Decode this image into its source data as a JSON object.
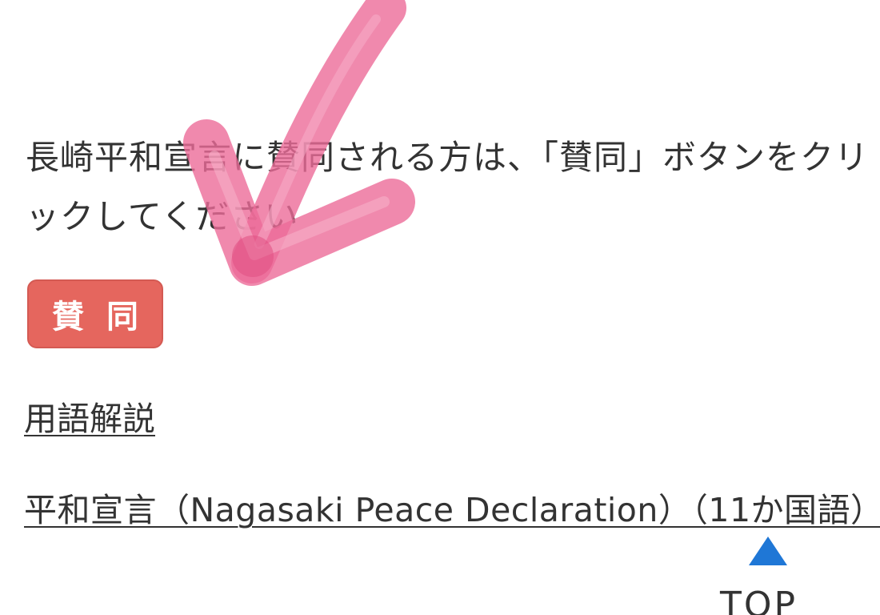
{
  "instruction_text": "長崎平和宣言に賛同される方は、「賛同」ボタンをクリックしてください",
  "agree_button_label": "賛同",
  "links": {
    "glossary": "用語解説",
    "declaration": "平和宣言（Nagasaki Peace Declaration）（11か国語）"
  },
  "top_button": {
    "label": "TOP",
    "icon": "up-triangle-icon"
  },
  "colors": {
    "agree_button": "#e5665e",
    "checkmark_overlay": "#e8568a",
    "top_arrow": "#1f77d6"
  }
}
